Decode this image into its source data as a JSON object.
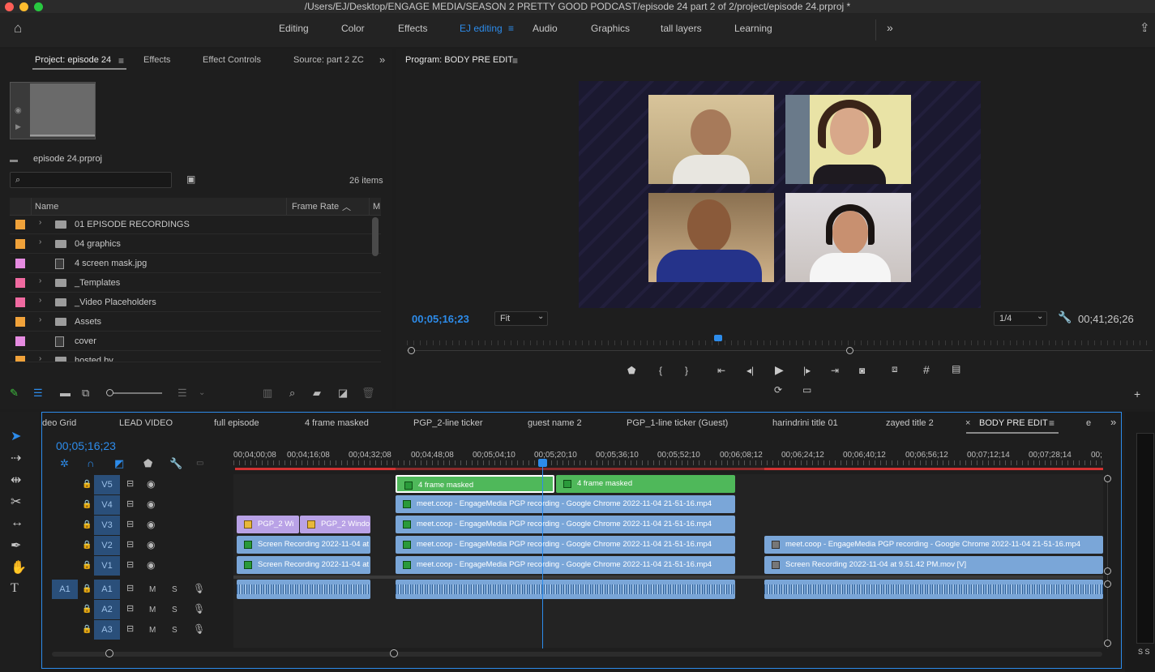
{
  "window": {
    "title": "/Users/EJ/Desktop/ENGAGE MEDIA/SEASON 2 PRETTY GOOD PODCAST/episode 24 part 2 of 2/project/episode 24.prproj *"
  },
  "workspaces": {
    "items": [
      "Editing",
      "Color",
      "Effects",
      "EJ editing",
      "Audio",
      "Graphics",
      "tall layers",
      "Learning"
    ],
    "active": "EJ editing",
    "more": "»"
  },
  "project_panel": {
    "tabs": [
      "Project: episode 24",
      "Effects",
      "Effect Controls",
      "Source: part 2 ZC"
    ],
    "file_name": "episode 24.prproj",
    "item_count": "26 items",
    "columns": {
      "name": "Name",
      "frame_rate": "Frame Rate",
      "media": "M"
    },
    "items": [
      {
        "label": "01 EPISODE RECORDINGS",
        "type": "folder",
        "color": "#f0a23a"
      },
      {
        "label": "04 graphics",
        "type": "folder",
        "color": "#f0a23a"
      },
      {
        "label": "4 screen mask.jpg",
        "type": "file",
        "color": "#e58be0"
      },
      {
        "label": "_Templates",
        "type": "folder",
        "color": "#f06aa0"
      },
      {
        "label": "_Video Placeholders",
        "type": "folder",
        "color": "#f06aa0"
      },
      {
        "label": "Assets",
        "type": "folder",
        "color": "#f0a23a"
      },
      {
        "label": "cover",
        "type": "file",
        "color": "#e58be0"
      },
      {
        "label": "hosted by",
        "type": "folder",
        "color": "#f0a23a"
      }
    ]
  },
  "program_monitor": {
    "tab": "Program: BODY PRE EDIT",
    "timecode": "00;05;16;23",
    "fit": "Fit",
    "resolution": "1/4",
    "duration": "00;41;26;26"
  },
  "timeline": {
    "tabs": [
      "deo Grid",
      "LEAD VIDEO",
      "full episode",
      "4 frame masked",
      "PGP_2-line ticker",
      "guest name 2",
      "PGP_1-line ticker (Guest)",
      "harindrini title 01",
      "zayed title 2",
      "BODY PRE EDIT",
      "e"
    ],
    "active_tab": "BODY PRE EDIT",
    "timecode": "00;05;16;23",
    "ruler": [
      "00;04;00;08",
      "00;04;16;08",
      "00;04;32;08",
      "00;04;48;08",
      "00;05;04;10",
      "00;05;20;10",
      "00;05;36;10",
      "00;05;52;10",
      "00;06;08;12",
      "00;06;24;12",
      "00;06;40;12",
      "00;06;56;12",
      "00;07;12;14",
      "00;07;28;14",
      "00;"
    ],
    "video_tracks": [
      "V5",
      "V4",
      "V3",
      "V2",
      "V1"
    ],
    "audio_tracks": [
      "A1",
      "A2",
      "A3"
    ],
    "source_patch": "A1",
    "track_letters": {
      "mute": "M",
      "solo": "S"
    },
    "clips": {
      "v5a": "4 frame masked",
      "v5b": "4 frame masked",
      "v4": "meet.coop - EngageMedia PGP recording - Google Chrome 2022-11-04 21-51-16.mp4",
      "v3a": "PGP_2 Wi",
      "v3b": "PGP_2 Windo",
      "v3c": "meet.coop - EngageMedia PGP recording - Google Chrome 2022-11-04 21-51-16.mp4",
      "v2a": "Screen Recording 2022-11-04 at",
      "v2b": "meet.coop - EngageMedia PGP recording - Google Chrome 2022-11-04 21-51-16.mp4",
      "v2c": "meet.coop - EngageMedia PGP recording - Google Chrome 2022-11-04 21-51-16.mp4",
      "v1a": "Screen Recording 2022-11-04 at",
      "v1b": "meet.coop - EngageMedia PGP recording - Google Chrome 2022-11-04 21-51-16.mp4",
      "v1c": "Screen Recording 2022-11-04 at 9.51.42 PM.mov [V]"
    }
  },
  "meter": {
    "labels": "S S"
  }
}
